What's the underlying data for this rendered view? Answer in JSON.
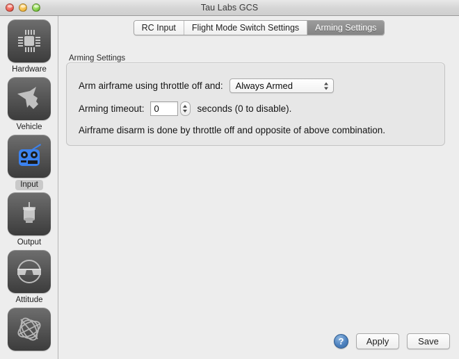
{
  "window": {
    "title": "Tau Labs GCS",
    "traffic_lights": [
      "close-red",
      "minimize-yellow",
      "zoom-green"
    ]
  },
  "sidebar": {
    "items": [
      {
        "label": "Hardware",
        "icon": "chip-icon",
        "selected": false
      },
      {
        "label": "Vehicle",
        "icon": "aircraft-icon",
        "selected": false
      },
      {
        "label": "Input",
        "icon": "rc-transmitter-icon",
        "selected": true
      },
      {
        "label": "Output",
        "icon": "motor-icon",
        "selected": false
      },
      {
        "label": "Attitude",
        "icon": "level-bubble-icon",
        "selected": false
      },
      {
        "label": "",
        "icon": "gyroscope-icon",
        "selected": false
      }
    ]
  },
  "tabs": [
    {
      "label": "RC Input",
      "active": false
    },
    {
      "label": "Flight Mode Switch Settings",
      "active": false
    },
    {
      "label": "Arming Settings",
      "active": true
    }
  ],
  "group": {
    "title": "Arming Settings",
    "arm_label": "Arm airframe using throttle off and:",
    "arm_value": "Always Armed",
    "timeout_label": "Arming timeout:",
    "timeout_value": "0",
    "timeout_unit": "seconds (0 to disable).",
    "note": "Airframe disarm is done by throttle off and opposite of above combination."
  },
  "footer": {
    "help_label": "?",
    "apply_label": "Apply",
    "save_label": "Save"
  },
  "colors": {
    "accent_blue": "#4e82bf",
    "tab_active_bg": "#8f8f8f",
    "window_bg": "#ededed",
    "group_bg": "#e7e7e7"
  }
}
